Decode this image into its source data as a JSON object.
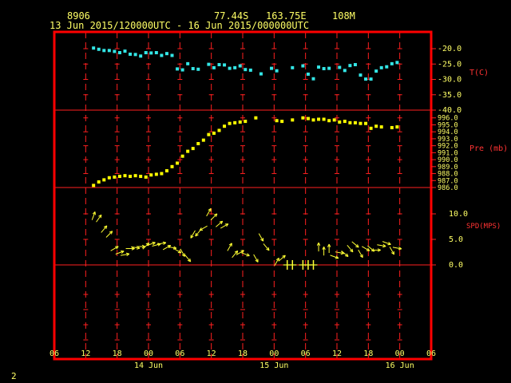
{
  "header": {
    "station_id": "8906",
    "lat": "77.44S",
    "lon": "163.75E",
    "elev": "108M",
    "time_range": "13 Jun 2015/120000UTC - 16 Jun 2015/000000UTC",
    "page_num": "2"
  },
  "colors": {
    "frame": "#ff0000",
    "grid": "#ff2020",
    "text": "#ffff66",
    "temperature": "#33e6e6",
    "pressure": "#ffff00",
    "wind": "#ffff33"
  },
  "chart_data": [
    {
      "type": "scatter",
      "ylabel": "T(C)",
      "ylim": [
        -40,
        -20
      ],
      "yticks": [
        "-20.0",
        "-25.0",
        "-30.0",
        "-35.0",
        "-40.0"
      ],
      "x": [
        13.5,
        14.5,
        15.5,
        16.5,
        17.5,
        18.5,
        19.5,
        20.5,
        21.5,
        22.5,
        23.5,
        24.5,
        25.5,
        26.5,
        27.5,
        28.5,
        29.5,
        30.5,
        31.5,
        32.5,
        33.5,
        35.5,
        36.5,
        37.5,
        38.5,
        39.5,
        40.5,
        41.5,
        42.5,
        43.5,
        45.5,
        47.5,
        48.5,
        51.5,
        53.5,
        54.5,
        55.5,
        56.5,
        57.5,
        58.5,
        60.5,
        61.5,
        62.5,
        63.5,
        64.5,
        65.5,
        66.5,
        67.5,
        68.5,
        69.5,
        70.5,
        71.5
      ],
      "y": [
        -19.8,
        -20.2,
        -20.6,
        -20.6,
        -20.9,
        -21.3,
        -20.8,
        -21.8,
        -21.9,
        -22.4,
        -21.3,
        -21.4,
        -21.3,
        -22.2,
        -21.6,
        -22.2,
        -26.6,
        -26.9,
        -24.9,
        -26.5,
        -26.7,
        -25.1,
        -26.2,
        -25.2,
        -25.3,
        -26.4,
        -26.2,
        -25.6,
        -26.8,
        -27.0,
        -28.2,
        -26.4,
        -27.2,
        -26.2,
        -25.6,
        -28.3,
        -29.8,
        -26.0,
        -26.5,
        -26.4,
        -26.1,
        -27.1,
        -25.5,
        -25.2,
        -28.6,
        -29.9,
        -29.9,
        -27.3,
        -26.2,
        -25.9,
        -24.9,
        -24.5
      ]
    },
    {
      "type": "scatter",
      "ylabel": "Pre (mb)",
      "ylim": [
        986,
        997
      ],
      "yticks": [
        "996.0",
        "995.0",
        "994.0",
        "993.0",
        "992.0",
        "991.0",
        "990.0",
        "989.0",
        "988.0",
        "987.0",
        "986.0"
      ],
      "x": [
        13.5,
        14.5,
        15.5,
        16.5,
        17.5,
        18.5,
        19.5,
        20.5,
        21.5,
        22.5,
        23.5,
        24.5,
        25.5,
        26.5,
        27.5,
        28.5,
        29.5,
        30.5,
        31.5,
        32.5,
        33.5,
        34.5,
        35.5,
        36.5,
        37.5,
        38.5,
        39.5,
        40.5,
        41.5,
        42.5,
        44.5,
        48.5,
        49.5,
        51.5,
        53.5,
        54.5,
        55.5,
        56.5,
        57.5,
        58.5,
        59.5,
        60.5,
        61.5,
        62.5,
        63.5,
        64.5,
        65.5,
        66.5,
        67.5,
        68.5,
        70.5,
        71.5
      ],
      "y": [
        986.3,
        986.8,
        987.1,
        987.4,
        987.5,
        987.6,
        987.7,
        987.6,
        987.7,
        987.6,
        987.5,
        987.8,
        987.9,
        988.0,
        988.4,
        989.0,
        989.5,
        990.5,
        991.2,
        991.6,
        992.3,
        992.8,
        993.6,
        993.8,
        994.2,
        994.8,
        995.2,
        995.3,
        995.4,
        995.5,
        996.0,
        995.6,
        995.5,
        995.7,
        996.0,
        995.9,
        995.7,
        995.8,
        995.8,
        995.6,
        995.7,
        995.4,
        995.5,
        995.3,
        995.3,
        995.2,
        995.2,
        994.5,
        994.8,
        994.7,
        994.6,
        994.7
      ]
    },
    {
      "type": "vector",
      "ylabel": "SPD(MPS)",
      "ylim": [
        -3,
        15
      ],
      "yticks": [
        "10.0",
        "5.0",
        "0.0"
      ],
      "speed": [
        9.6,
        9.1,
        7.0,
        6.0,
        3.2,
        2.4,
        2.0,
        3.2,
        3.4,
        3.6,
        3.7,
        4.1,
        3.9,
        4.2,
        3.4,
        3.4,
        2.8,
        2.4,
        1.3,
        6.0,
        6.3,
        7.2,
        10.3,
        9.4,
        8.0,
        7.6,
        3.5,
        2.1,
        2.4,
        2.1,
        1.3,
        5.4,
        3.5,
        0.6,
        1.3,
        0.0,
        0.0,
        0.0,
        0.0,
        0.0,
        3.5,
        2.7,
        3.2,
        1.6,
        2.4,
        2.2,
        3.2,
        4.0,
        2.2,
        3.2,
        3.2,
        2.9,
        3.8,
        4.3,
        2.8,
        3.3,
        4.3,
        0.0
      ],
      "dir_deg": [
        20,
        35,
        40,
        45,
        60,
        70,
        80,
        90,
        100,
        90,
        45,
        70,
        75,
        80,
        60,
        100,
        120,
        150,
        140,
        210,
        220,
        240,
        30,
        45,
        50,
        60,
        30,
        40,
        60,
        110,
        150,
        150,
        140,
        30,
        50,
        250,
        260,
        0,
        0,
        0,
        0,
        0,
        0,
        110,
        100,
        130,
        140,
        130,
        150,
        120,
        130,
        90,
        100,
        110,
        150,
        100,
        150,
        0
      ],
      "x": [
        13.5,
        14.5,
        15.5,
        16.5,
        17.5,
        18.5,
        19.5,
        20.5,
        21.5,
        22.5,
        23.5,
        24.5,
        25.5,
        26.5,
        27.5,
        28.5,
        29.5,
        30.5,
        31.5,
        32.5,
        33.5,
        34.5,
        35.5,
        36.5,
        37.5,
        38.5,
        39.5,
        40.5,
        41.5,
        42.5,
        44.5,
        45.5,
        46.5,
        48.5,
        49.5,
        50.5,
        51.5,
        53.5,
        54.5,
        55.5,
        56.5,
        57.5,
        58.5,
        59.5,
        60.5,
        61.5,
        62.5,
        63.5,
        64.5,
        65.5,
        66.5,
        67.5,
        68.5,
        69.5,
        70.5,
        71.5
      ]
    }
  ],
  "x_axis": {
    "x": [
      6,
      12,
      18,
      24,
      30,
      36,
      42,
      48,
      54,
      60,
      66,
      72,
      78
    ],
    "tick_labels": [
      "06",
      "12",
      "18",
      "00",
      "06",
      "12",
      "18",
      "00",
      "06",
      "12",
      "18",
      "00",
      "06"
    ],
    "day_labels": [
      {
        "x": 24,
        "label": "14 Jun"
      },
      {
        "x": 48,
        "label": "15 Jun"
      },
      {
        "x": 72,
        "label": "16 Jun"
      }
    ]
  }
}
